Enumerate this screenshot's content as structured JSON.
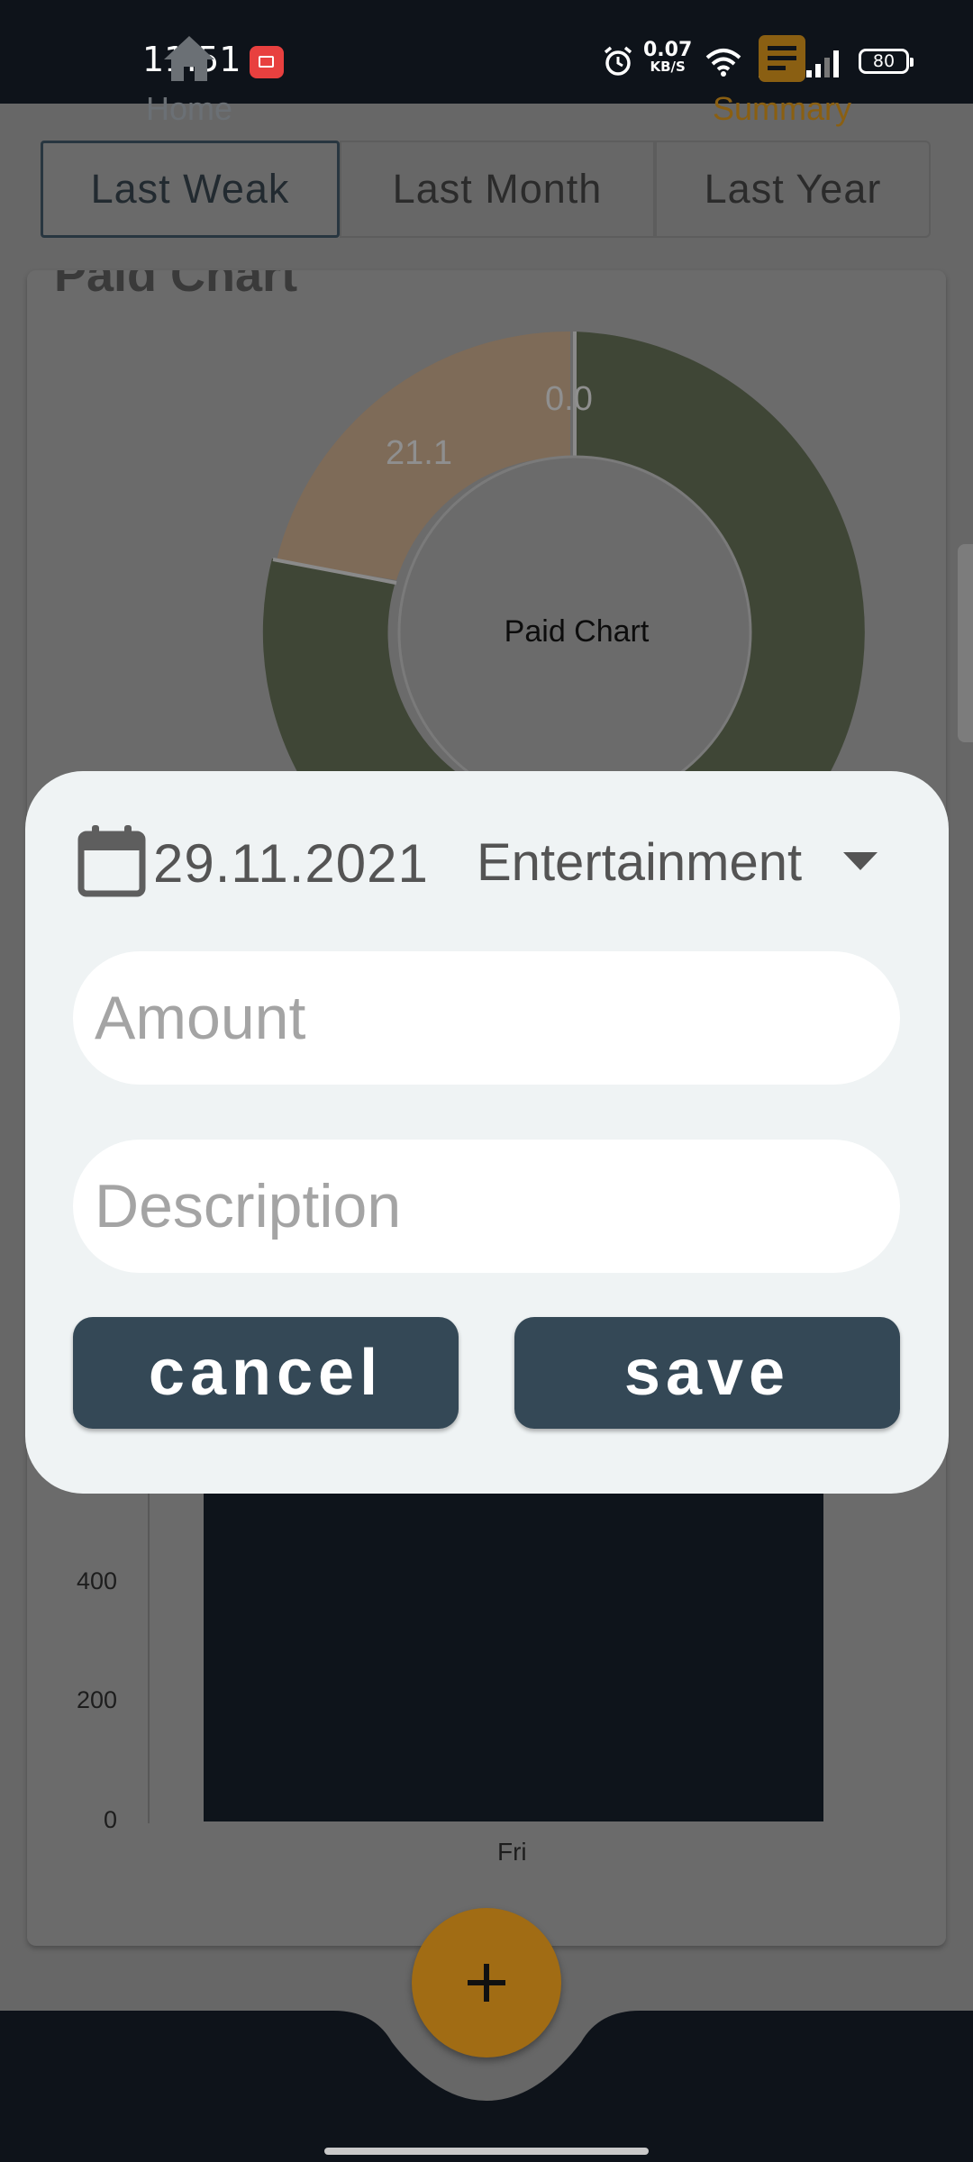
{
  "status_bar": {
    "time": "11:51",
    "net_speed_value": "0.07",
    "net_speed_unit": "KB/S",
    "battery": "80"
  },
  "tabs": [
    {
      "label": "Last Weak",
      "active": true
    },
    {
      "label": "Last Month",
      "active": false
    },
    {
      "label": "Last Year",
      "active": false
    }
  ],
  "card": {
    "title": "Paid Chart"
  },
  "chart_data": [
    {
      "type": "pie",
      "title": "Paid Chart",
      "slices": [
        {
          "value": 0.0,
          "color": "#3f4636"
        },
        {
          "value": 21.1,
          "color": "#7e6b58"
        }
      ]
    },
    {
      "type": "bar",
      "categories": [
        "Fri"
      ],
      "values": [
        600
      ],
      "yticks": [
        0,
        200,
        400
      ],
      "color": "#0e141b"
    }
  ],
  "dialog": {
    "date": "29.11.2021",
    "category": "Entertainment",
    "amount_placeholder": "Amount",
    "description_placeholder": "Description",
    "cancel_label": "cancel",
    "save_label": "save"
  },
  "bottom_nav": {
    "home_label": "Home",
    "summary_label": "Summary",
    "active_color": "#8a5f12"
  },
  "colors": {
    "accent": "#a16c14",
    "button": "#344856",
    "dialog_bg": "#eff3f4"
  }
}
